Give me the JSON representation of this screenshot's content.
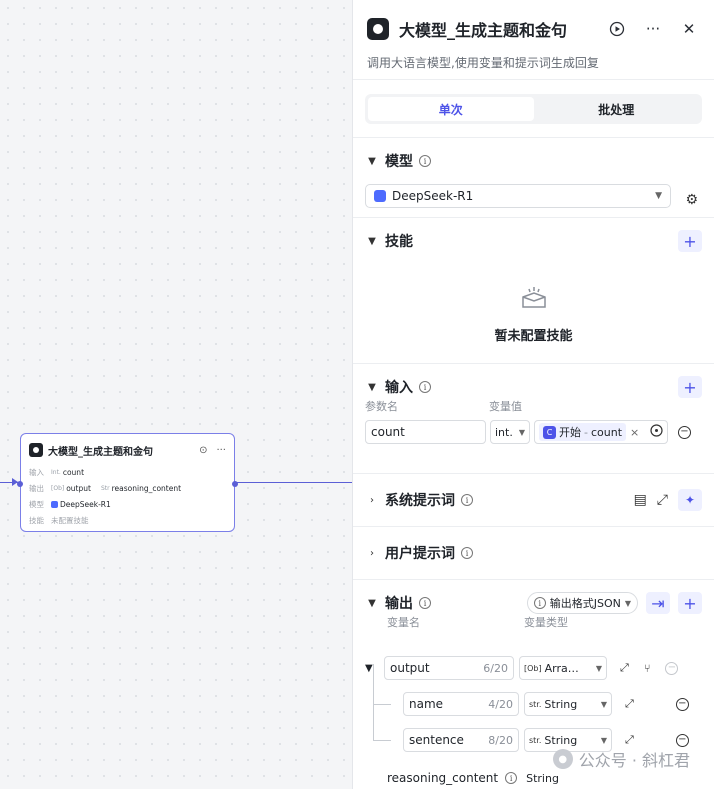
{
  "node": {
    "title": "大模型_生成主题和金句",
    "input_label": "输入",
    "input_value": "count",
    "input_prefix": "Int.",
    "output_label": "输出",
    "output_prefix": "[Ob]",
    "output_value_1": "output",
    "output_prefix_2": "Str",
    "output_value_2": "reasoning_content",
    "model_label": "模型",
    "model_value": "DeepSeek-R1",
    "skill_label": "技能",
    "skill_value": "未配置技能"
  },
  "panel": {
    "title": "大模型_生成主题和金句",
    "description": "调用大语言模型,使用变量和提示词生成回复",
    "tabs": [
      {
        "label": "单次",
        "active": true
      },
      {
        "label": "批处理",
        "active": false
      }
    ],
    "model_section": {
      "title": "模型",
      "selected": "DeepSeek-R1"
    },
    "skills_section": {
      "title": "技能",
      "empty_text": "暂未配置技能"
    },
    "input_section": {
      "title": "输入",
      "col_param": "参数名",
      "col_value": "变量值",
      "rows": [
        {
          "name": "count",
          "type": "int.",
          "ref_source": "开始",
          "ref_sep": "-",
          "ref_var": "count"
        }
      ]
    },
    "system_prompt": {
      "title": "系统提示词"
    },
    "user_prompt": {
      "title": "用户提示词"
    },
    "output_section": {
      "title": "输出",
      "format_label": "输出格式JSON",
      "col_name": "变量名",
      "col_type": "变量类型",
      "rows": [
        {
          "name": "output",
          "count": "6/20",
          "type_prefix": "[Ob]",
          "type": "Arra…"
        },
        {
          "name": "name",
          "count": "4/20",
          "type_prefix": "str.",
          "type": "String"
        },
        {
          "name": "sentence",
          "count": "8/20",
          "type_prefix": "str.",
          "type": "String"
        }
      ],
      "reasoning": {
        "name": "reasoning_content",
        "type": "String"
      }
    }
  },
  "watermark": {
    "text": "公众号 · 斜杠君"
  },
  "colors": {
    "accent": "#4d53e8",
    "edge": "#5b5fd6",
    "deepseek": "#4d6bfe"
  }
}
